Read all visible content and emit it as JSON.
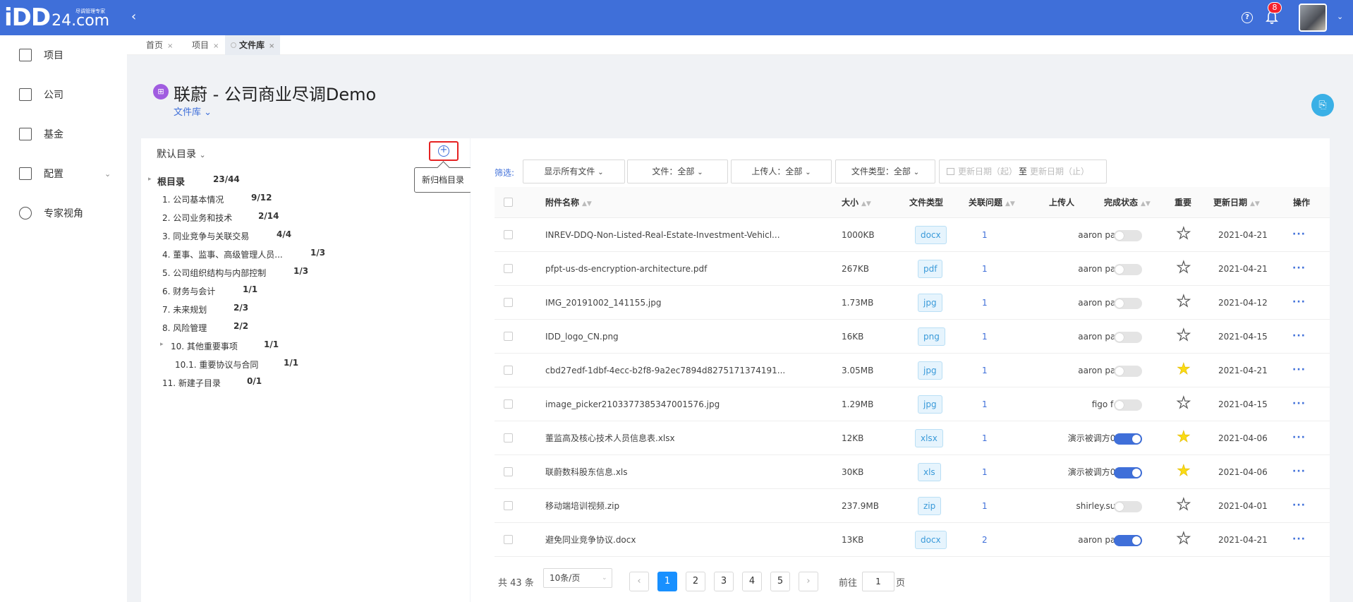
{
  "app": {
    "logo_mark": "iDD",
    "logo_domain": "24.com",
    "logo_slogan": "尽调管理专家",
    "notification_count": "8"
  },
  "sidebar": {
    "items": [
      {
        "label": "项目",
        "icon": "project-doc-icon"
      },
      {
        "label": "公司",
        "icon": "company-building-icon"
      },
      {
        "label": "基金",
        "icon": "fund-chart-icon"
      },
      {
        "label": "配置",
        "icon": "config-icon"
      },
      {
        "label": "专家视角",
        "icon": "expert-icon"
      }
    ]
  },
  "tabs": [
    {
      "label": "首页"
    },
    {
      "label": "项目"
    },
    {
      "label": "文件库",
      "active": true
    }
  ],
  "header": {
    "title": "联蔚 - 公司商业尽调Demo",
    "subtitle": "文件库"
  },
  "tree": {
    "directory_selector": "默认目录",
    "add_tooltip": "新归档目录",
    "nodes": [
      {
        "name": "根目录",
        "count": "23/44"
      },
      {
        "name": "1. 公司基本情况",
        "count": "9/12"
      },
      {
        "name": "2. 公司业务和技术",
        "count": "2/14"
      },
      {
        "name": "3. 同业竞争与关联交易",
        "count": "4/4"
      },
      {
        "name": "4. 董事、监事、高级管理人员...",
        "count": "1/3"
      },
      {
        "name": "5. 公司组织结构与内部控制",
        "count": "1/3"
      },
      {
        "name": "6. 财务与会计",
        "count": "1/1"
      },
      {
        "name": "7. 未来规划",
        "count": "2/3"
      },
      {
        "name": "8. 风险管理",
        "count": "2/2"
      },
      {
        "name": "10. 其他重要事项",
        "count": "1/1"
      },
      {
        "name": "10.1. 重要协议与合同",
        "count": "1/1"
      },
      {
        "name": "11. 新建子目录",
        "count": "0/1"
      }
    ]
  },
  "filters": {
    "label": "筛选:",
    "show_all": "显示所有文件",
    "file": "文件：全部",
    "uploader": "上传人：全部",
    "file_type": "文件类型：全部",
    "date_start": "更新日期（起）",
    "date_sep": "至",
    "date_end": "更新日期（止）"
  },
  "table": {
    "columns": {
      "name": "附件名称",
      "size": "大小",
      "type": "文件类型",
      "issues": "关联问题",
      "uploader": "上传人",
      "status": "完成状态",
      "important": "重要",
      "date": "更新日期",
      "actions": "操作"
    },
    "rows": [
      {
        "name": "INREV-DDQ-Non-Listed-Real-Estate-Investment-Vehicl...",
        "size": "1000KB",
        "type": "docx",
        "issues": "1",
        "uploader": "aaron pan",
        "done": false,
        "important": false,
        "date": "2021-04-21",
        "more": "···"
      },
      {
        "name": "pfpt-us-ds-encryption-architecture.pdf",
        "size": "267KB",
        "type": "pdf",
        "issues": "1",
        "uploader": "aaron pan",
        "done": false,
        "important": false,
        "date": "2021-04-21",
        "more": "···"
      },
      {
        "name": "IMG_20191002_141155.jpg",
        "size": "1.73MB",
        "type": "jpg",
        "issues": "1",
        "uploader": "aaron pan",
        "done": false,
        "important": false,
        "date": "2021-04-12",
        "more": "···"
      },
      {
        "name": "IDD_logo_CN.png",
        "size": "16KB",
        "type": "png",
        "issues": "1",
        "uploader": "aaron pan",
        "done": false,
        "important": false,
        "date": "2021-04-15",
        "more": "···"
      },
      {
        "name": "cbd27edf-1dbf-4ecc-b2f8-9a2ec7894d8275171374191...",
        "size": "3.05MB",
        "type": "jpg",
        "issues": "1",
        "uploader": "aaron pan",
        "done": false,
        "important": true,
        "date": "2021-04-21",
        "more": "···"
      },
      {
        "name": "image_picker2103377385347001576.jpg",
        "size": "1.29MB",
        "type": "jpg",
        "issues": "1",
        "uploader": "figo fei",
        "done": false,
        "important": false,
        "date": "2021-04-15",
        "more": "···"
      },
      {
        "name": "董监高及核心技术人员信息表.xlsx",
        "size": "12KB",
        "type": "xlsx",
        "issues": "1",
        "uploader": "演示被调方01",
        "done": true,
        "important": true,
        "date": "2021-04-06",
        "more": "···"
      },
      {
        "name": "联蔚数科股东信息.xls",
        "size": "30KB",
        "type": "xls",
        "issues": "1",
        "uploader": "演示被调方01",
        "done": true,
        "important": true,
        "date": "2021-04-06",
        "more": "···"
      },
      {
        "name": "移动端培训视频.zip",
        "size": "237.9MB",
        "type": "zip",
        "issues": "1",
        "uploader": "shirley.sun",
        "done": false,
        "important": false,
        "date": "2021-04-01",
        "more": "···"
      },
      {
        "name": "避免同业竞争协议.docx",
        "size": "13KB",
        "type": "docx",
        "issues": "2",
        "uploader": "aaron pan",
        "done": true,
        "important": false,
        "date": "2021-04-21",
        "more": "···"
      }
    ]
  },
  "pagination": {
    "total": "共 43 条",
    "page_size": "10条/页",
    "pages": [
      "1",
      "2",
      "3",
      "4",
      "5"
    ],
    "current": "1",
    "goto_label": "前往",
    "goto_value": "1",
    "goto_suffix": "页"
  },
  "colors": {
    "brand": "#3f6fd9",
    "star_on": "#fadb14",
    "highlight_box": "#e52222"
  }
}
